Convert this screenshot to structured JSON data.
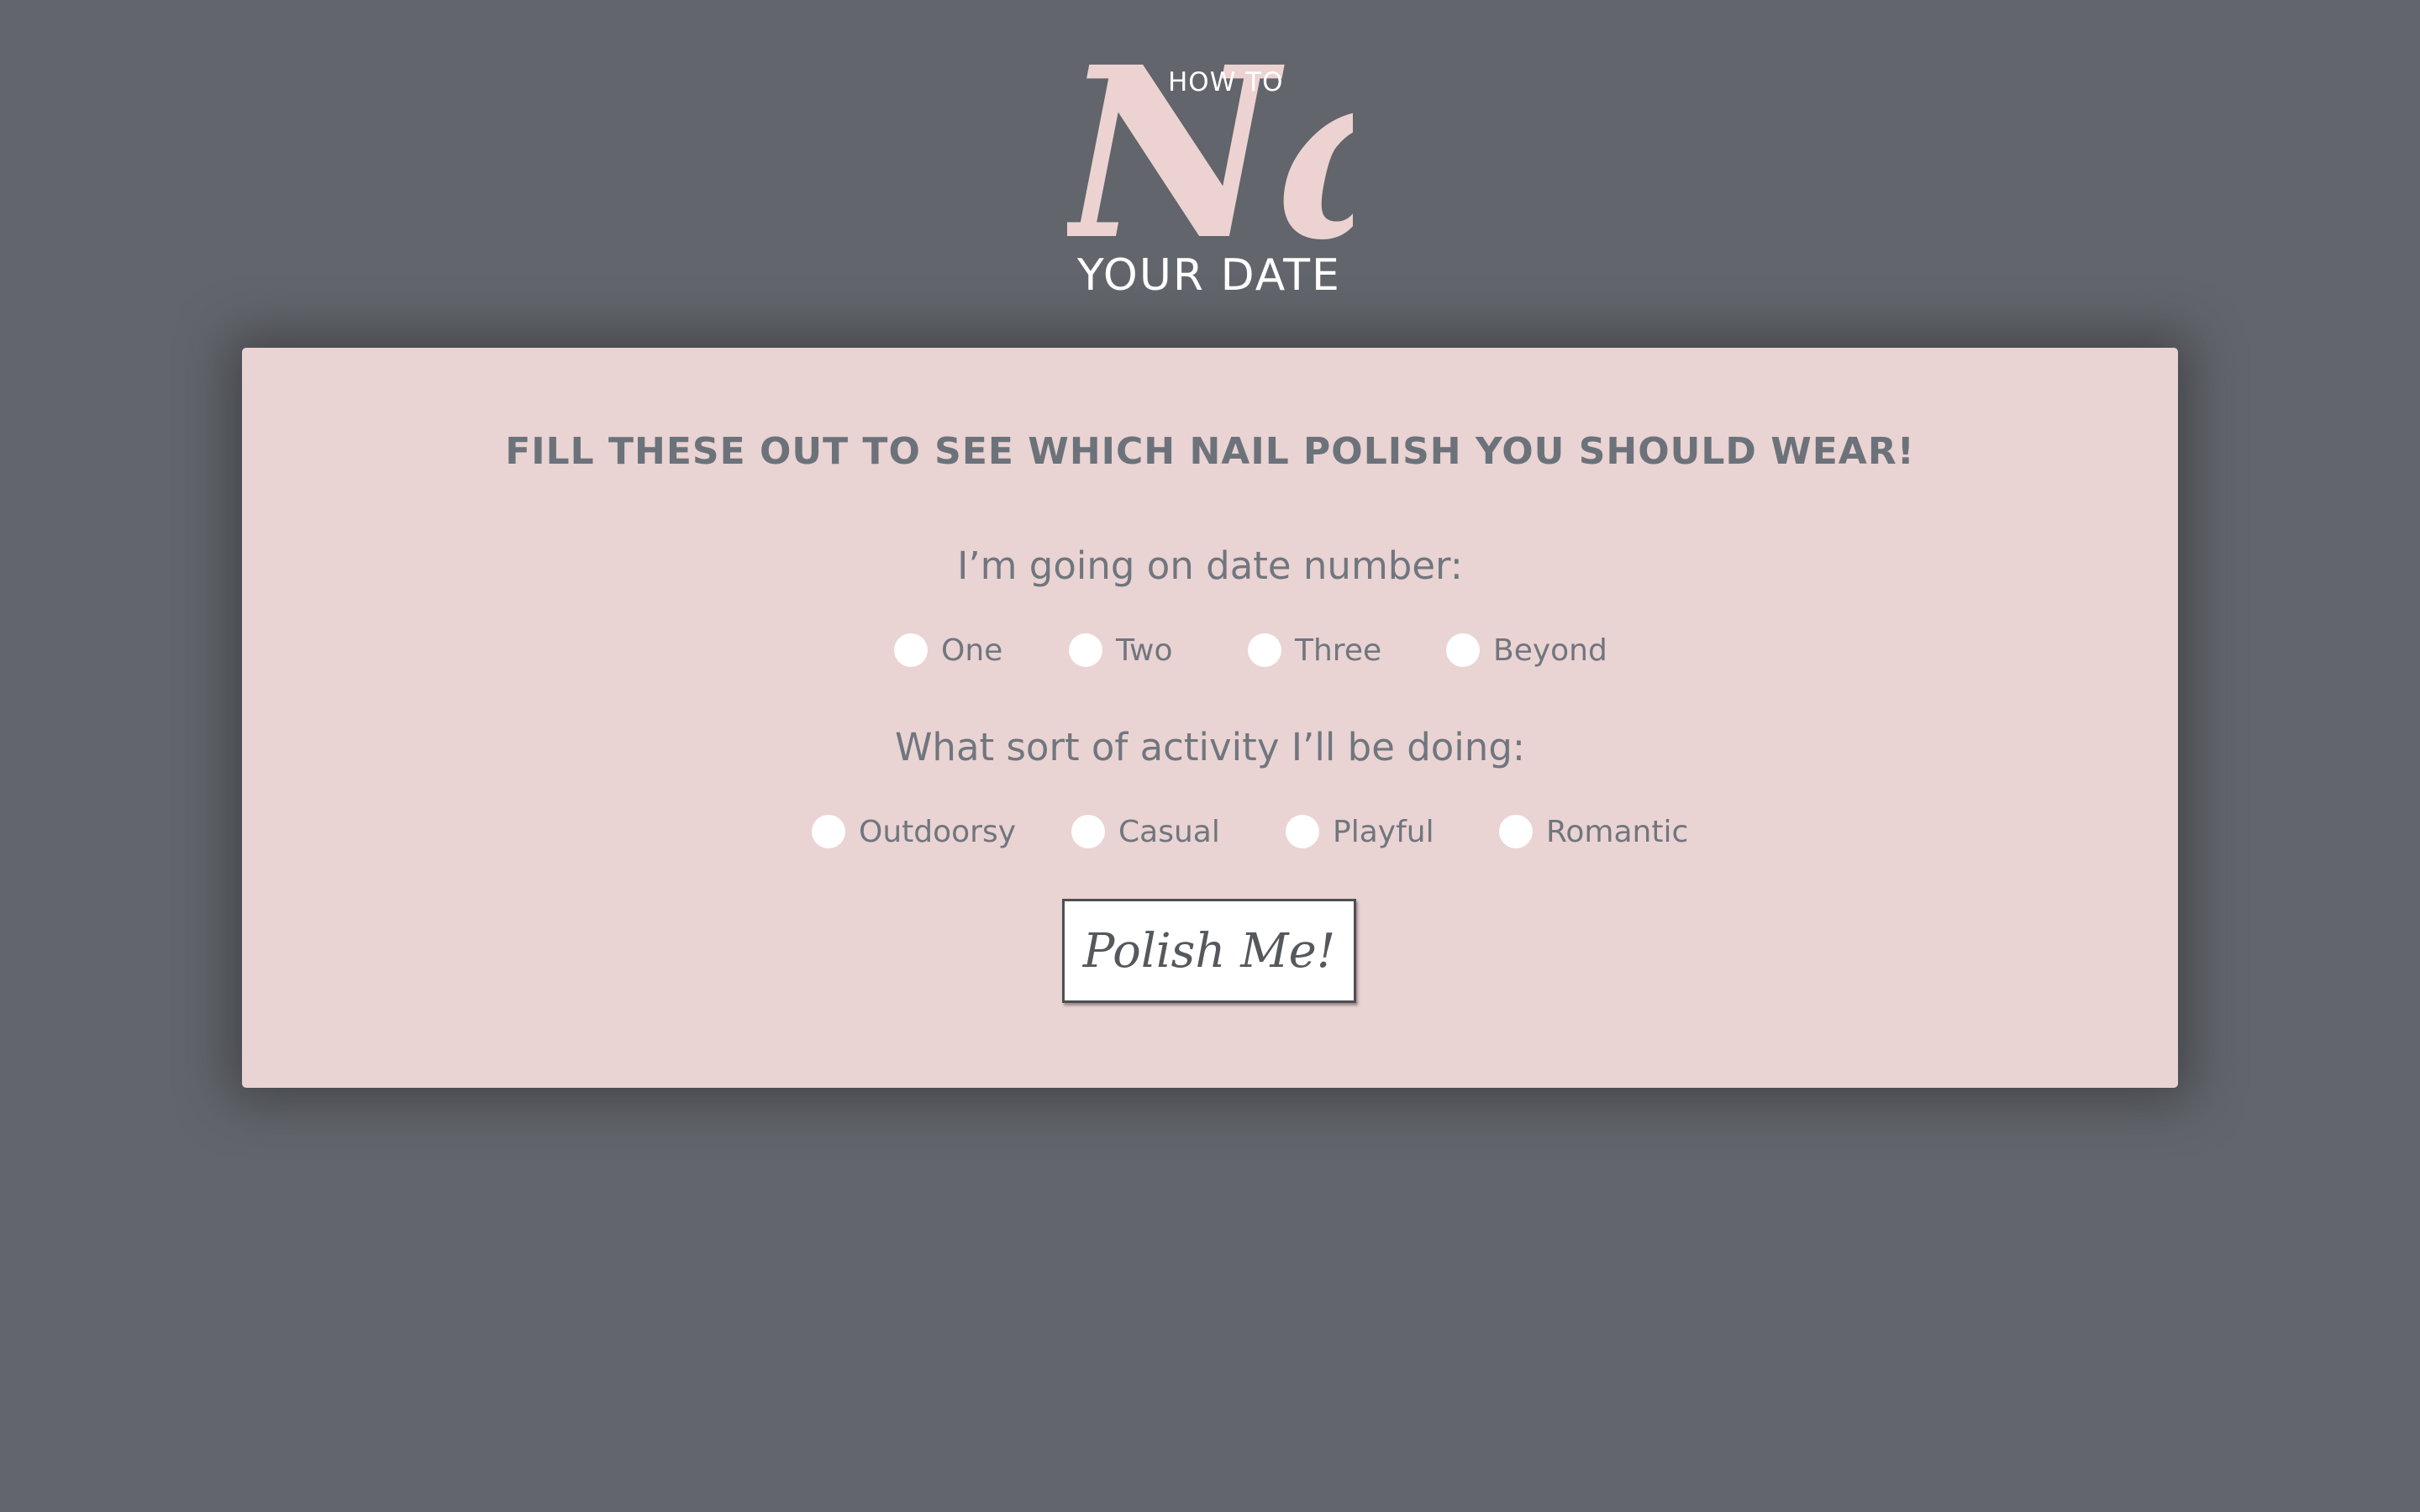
{
  "logo": {
    "top_text": "HOW TO",
    "script_text": "Nail",
    "bottom_text": "YOUR DATE"
  },
  "form": {
    "heading": "FILL THESE OUT TO SEE WHICH NAIL POLISH YOU SHOULD WEAR!",
    "question_date": {
      "label": "I’m going on date number:",
      "options": [
        "One",
        "Two",
        "Three",
        "Beyond"
      ]
    },
    "question_activity": {
      "label": "What sort of activity I’ll be doing:",
      "options": [
        "Outdoorsy",
        "Casual",
        "Playful",
        "Romantic"
      ]
    },
    "submit_label": "Polish Me!"
  },
  "colors": {
    "background": "#62656b",
    "card": "#ead3d3",
    "logo_accent": "#ecd3d2",
    "text_gray": "#70767e"
  }
}
